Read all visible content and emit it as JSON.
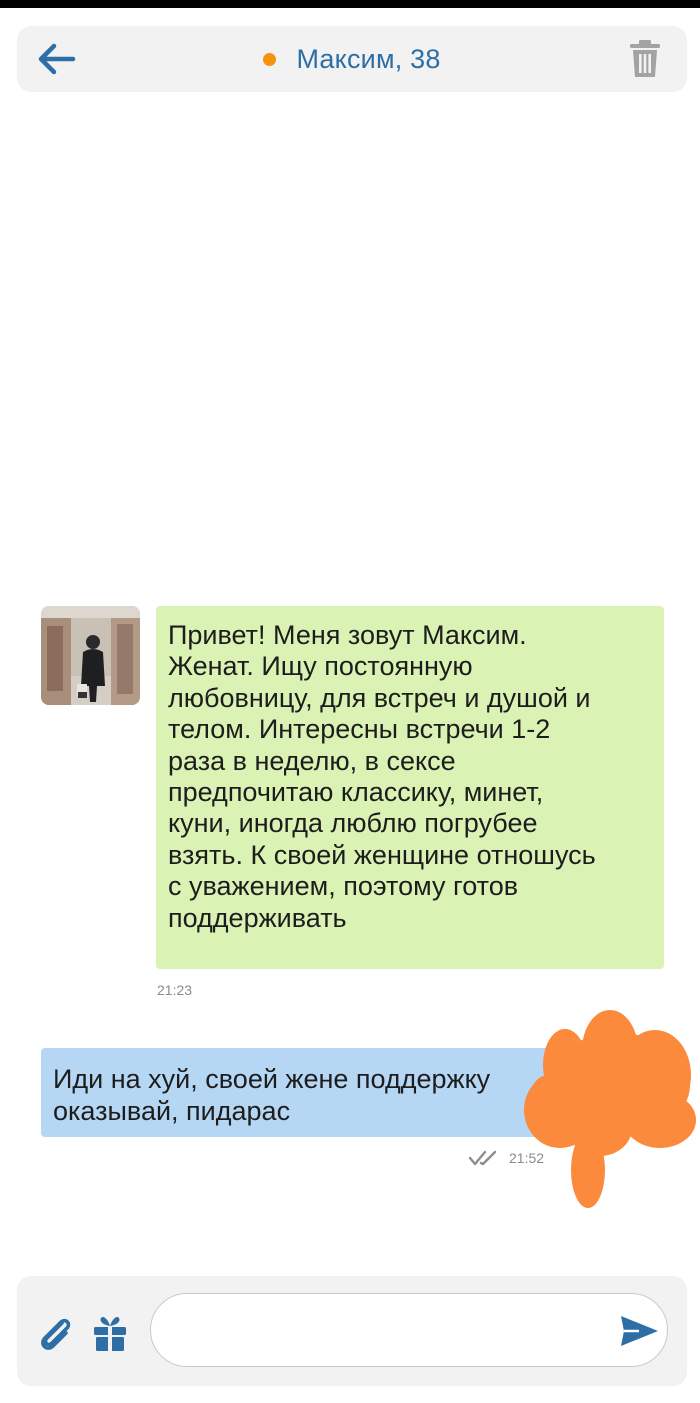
{
  "header": {
    "title": "Максим, 38",
    "status_color": "#f5940c",
    "back_icon": "arrow-left-icon",
    "delete_icon": "trash-icon"
  },
  "messages": [
    {
      "direction": "incoming",
      "text": "Привет! Меня зовут Максим. Женат. Ищу постоянную любовницу, для встреч и душой и телом. Интересны встречи 1-2 раза в неделю, в сексе предпочитаю классику, минет, куни, иногда люблю погрубее взять. К своей женщине отношусь с уважением, поэтому готов поддерживать",
      "lines": [
        "Привет! Меня зовут Максим.",
        "Женат. Ищу постоянную",
        "любовницу, для встреч и душой и",
        "телом. Интересны встречи 1-2",
        "раза в неделю, в сексе",
        "предпочитаю классику, минет,",
        "куни, иногда люблю погрубее",
        "взять. К своей женщине отношусь",
        "с уважением, поэтому готов",
        "поддерживать"
      ],
      "time": "21:23",
      "bubble_color": "#daf3b4"
    },
    {
      "direction": "outgoing",
      "text": "Иди на хуй, своей жене поддержку оказывай, пидарас",
      "lines": [
        "Иди на хуй, своей жене поддержку",
        "оказывай, пидарас"
      ],
      "time": "21:52",
      "read_icon": "double-check-icon",
      "bubble_color": "#b6d7f3"
    }
  ],
  "composer": {
    "input_value": "",
    "placeholder": "",
    "attach_icon": "paperclip-icon",
    "gift_icon": "gift-icon",
    "send_icon": "send-icon"
  },
  "colors": {
    "accent": "#2d6fa5",
    "redaction": "#fb8a3c"
  }
}
